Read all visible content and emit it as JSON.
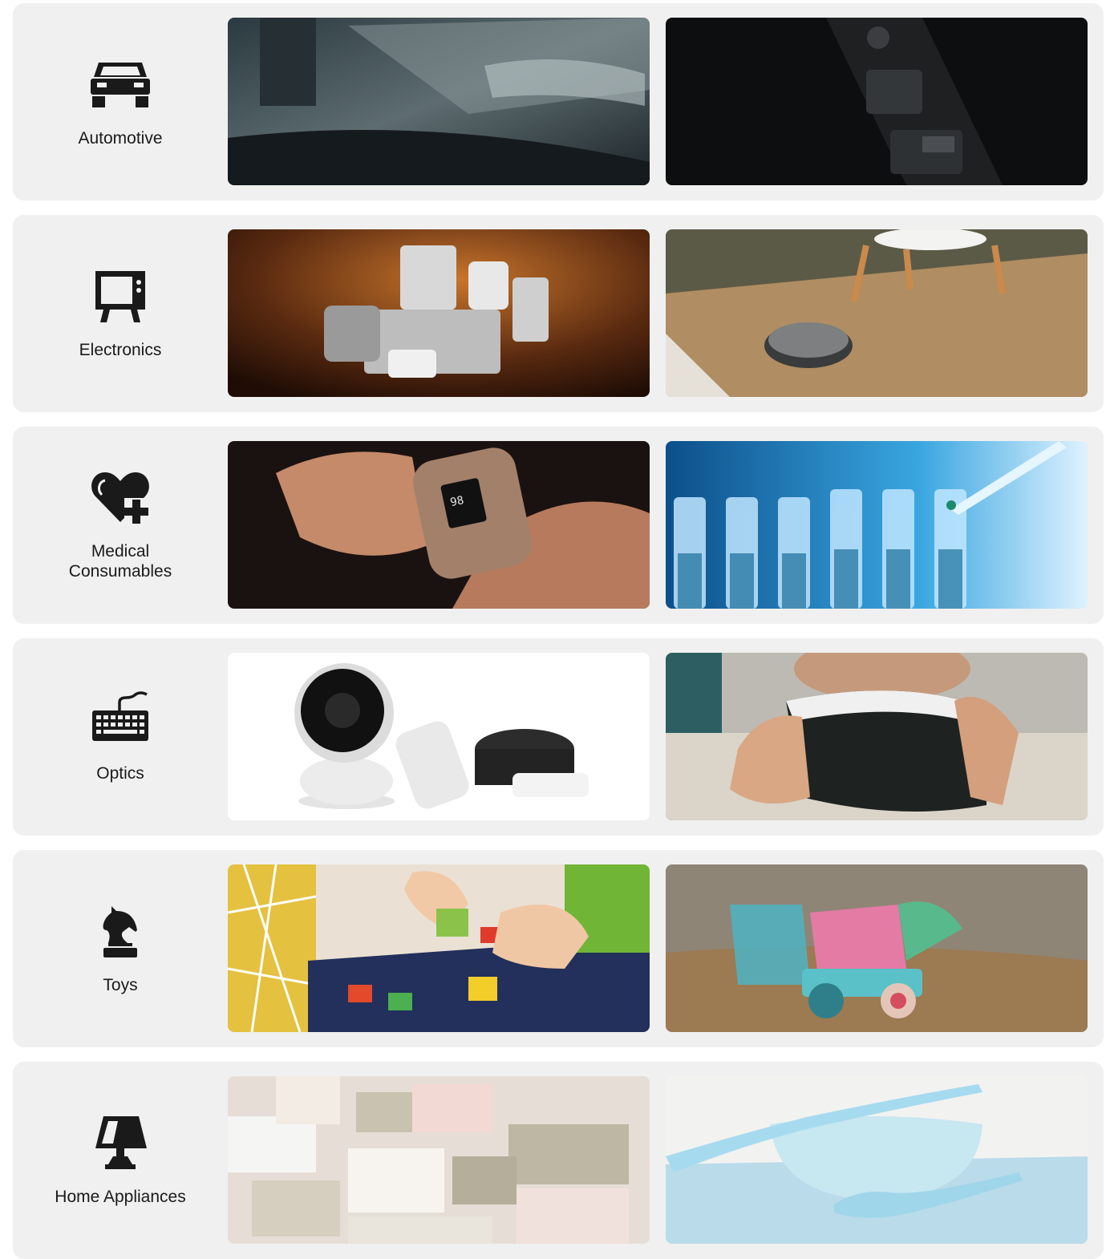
{
  "categories": [
    {
      "label": "Automotive",
      "icon": "car-icon",
      "photos": [
        "car-door-interior-photo",
        "car-window-switch-photo"
      ]
    },
    {
      "label": "Electronics",
      "icon": "tv-icon",
      "photos": [
        "kitchen-appliances-photo",
        "robot-vacuum-photo"
      ]
    },
    {
      "label": "Medical\nConsumables",
      "icon": "heart-plus-icon",
      "photos": [
        "pulse-oximeter-photo",
        "lab-test-tubes-photo"
      ]
    },
    {
      "label": "Optics",
      "icon": "keyboard-icon",
      "photos": [
        "smart-home-devices-photo",
        "vr-headset-photo"
      ]
    },
    {
      "label": "Toys",
      "icon": "chess-knight-icon",
      "photos": [
        "building-blocks-photo",
        "toy-truck-sand-photo"
      ]
    },
    {
      "label": "Home Appliances",
      "icon": "lamp-icon",
      "photos": [
        "storage-baskets-photo",
        "bowl-spoon-photo"
      ]
    }
  ],
  "colors": {
    "card_bg": "#eff0ef",
    "icon": "#1a1a1a",
    "text": "#1a1a1a"
  }
}
